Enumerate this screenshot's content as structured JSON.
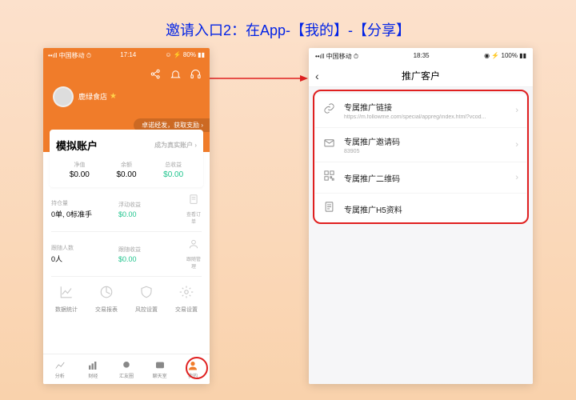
{
  "caption": "邀请入口2：在App-【我的】-【分享】",
  "phone1": {
    "status": {
      "carrier": "••ıll 中国移动  ⏱",
      "time": "17:14",
      "battery": "☺ ⚡ 80% ▮▮"
    },
    "username": "鹿绿食店",
    "pill": "卓诺经发，获取支励 ›",
    "account_title": "模拟账户",
    "become": "成为真实账户 ›",
    "metrics": [
      {
        "label": "净值",
        "value": "$0.00"
      },
      {
        "label": "余额",
        "value": "$0.00"
      },
      {
        "label": "总收益",
        "value": "$0.00",
        "green": true
      }
    ],
    "sec1": {
      "l_label": "持仓量",
      "l_value": "0单, 0标准手",
      "r_label": "浮动收益",
      "r_value": "$0.00",
      "icon_label": "查看订单"
    },
    "sec2": {
      "l_label": "跟随人数",
      "l_value": "0人",
      "r_label": "跟随收益",
      "r_value": "$0.00",
      "icon_label": "跟随管理"
    },
    "grid": [
      "数据统计",
      "交易报表",
      "风控设置",
      "交易设置"
    ],
    "tabs": [
      "分析",
      "财经",
      "汇友圈",
      "聊天室",
      "我的"
    ]
  },
  "phone2": {
    "status": {
      "carrier": "••ıll 中国移动 ⏱",
      "time": "18:35",
      "battery": "◉ ⚡ 100% ▮▮"
    },
    "title": "推广客户",
    "rows": [
      {
        "title": "专属推广链接",
        "sub": "https://m.followme.com/special/appreg/index.html?vcod...",
        "icon": "link",
        "chev": true
      },
      {
        "title": "专属推广邀请码",
        "sub": "83905",
        "icon": "mail",
        "chev": true
      },
      {
        "title": "专属推广二维码",
        "sub": "",
        "icon": "qr",
        "chev": true
      },
      {
        "title": "专属推广H5资料",
        "sub": "",
        "icon": "page",
        "chev": false
      }
    ]
  }
}
